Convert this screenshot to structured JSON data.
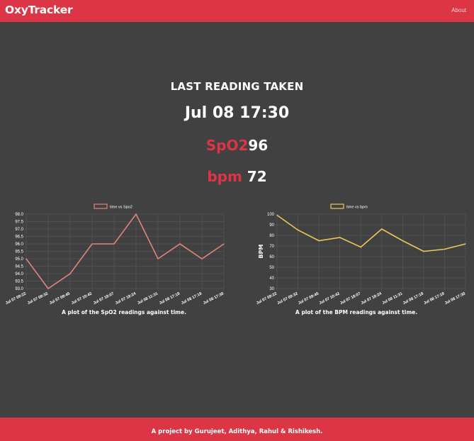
{
  "navbar": {
    "brand": "OxyTracker",
    "about_link": "About"
  },
  "reading": {
    "title": "LAST READING TAKEN",
    "timestamp": "Jul 08 17:30",
    "spo2_label": "SpO2",
    "spo2_value": "96",
    "bpm_label": "bpm",
    "bpm_value": "72"
  },
  "colors": {
    "accent": "#dc3545",
    "background": "#414141",
    "spo2_line": "#e5837c",
    "bpm_line": "#e8c857",
    "grid": "#555555",
    "tick_text": "#ffffff"
  },
  "chart_data": [
    {
      "type": "line",
      "title": "",
      "xlabel": "",
      "ylabel": "",
      "legend_position": "top",
      "categories": [
        "Jul 07 09:22",
        "Jul 07 09:32",
        "Jul 07 09:45",
        "Jul 07 10:42",
        "Jul 07 18:07",
        "Jul 07 18:24",
        "Jul 08 11:31",
        "Jul 08 17:18",
        "Jul 08 17:18",
        "Jul 08 17:30"
      ],
      "series": [
        {
          "name": "time vs Spo2",
          "values": [
            95,
            93,
            94,
            96,
            96,
            98,
            95,
            96,
            95,
            96
          ]
        }
      ],
      "ylim": [
        93.0,
        98.0
      ],
      "yticks": [
        "98.0",
        "97.5",
        "97.0",
        "96.5",
        "96.0",
        "95.5",
        "95.0",
        "94.5",
        "94.0",
        "93.5",
        "93.0"
      ],
      "grid": true,
      "caption": "A plot of the SpO2 readings against time."
    },
    {
      "type": "line",
      "title": "",
      "xlabel": "",
      "ylabel": "BPM",
      "legend_position": "top",
      "categories": [
        "Jul 07 09:22",
        "Jul 07 09:32",
        "Jul 07 09:45",
        "Jul 07 10:42",
        "Jul 07 18:07",
        "Jul 07 18:24",
        "Jul 08 11:31",
        "Jul 08 17:18",
        "Jul 08 17:18",
        "Jul 08 17:30"
      ],
      "series": [
        {
          "name": "time vs bpm",
          "values": [
            99,
            85,
            75,
            78,
            69,
            86,
            75,
            65,
            67,
            72
          ]
        }
      ],
      "ylim": [
        30,
        100
      ],
      "yticks": [
        "100",
        "90",
        "80",
        "70",
        "60",
        "50",
        "40",
        "30"
      ],
      "grid": true,
      "caption": "A plot of the BPM readings against time."
    }
  ],
  "footer": {
    "text": "A project by Gurujeet, Adithya, Rahul & Rishikesh."
  }
}
